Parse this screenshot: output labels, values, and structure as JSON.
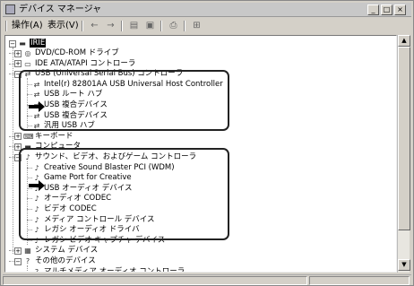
{
  "window": {
    "title": "デバイス マネージャ"
  },
  "menu": {
    "items": [
      "操作(A)",
      "表示(V)"
    ]
  },
  "toolbar": {
    "icons": [
      "back-icon",
      "forward-icon",
      "properties-icon",
      "refresh-icon",
      "print-icon",
      "scan-icon"
    ]
  },
  "tree": {
    "root": "IRIE",
    "nodes": [
      {
        "label": "DVD/CD-ROM ドライブ",
        "icon": "cdrom-icon",
        "level": 1,
        "expander": "+"
      },
      {
        "label": "IDE ATA/ATAPI コントローラ",
        "icon": "ide-icon",
        "level": 1,
        "expander": "+"
      },
      {
        "label": "USB (Universal Serial Bus) コントローラ",
        "icon": "usb-icon",
        "level": 1,
        "expander": "-"
      },
      {
        "label": "Intel(r) 82801AA USB Universal Host Controller",
        "icon": "usb-icon",
        "level": 2
      },
      {
        "label": "USB ルート ハブ",
        "icon": "usb-icon",
        "level": 2
      },
      {
        "label": "USB 複合デバイス",
        "icon": "usb-icon",
        "level": 2
      },
      {
        "label": "USB 複合デバイス",
        "icon": "usb-icon",
        "level": 2
      },
      {
        "label": "汎用 USB ハブ",
        "icon": "usb-icon",
        "level": 2
      },
      {
        "label": "キーボード",
        "icon": "keyboard-icon",
        "level": 1,
        "expander": "+"
      },
      {
        "label": "コンピュータ",
        "icon": "computer-icon",
        "level": 1,
        "expander": "+"
      },
      {
        "label": "サウンド、ビデオ、およびゲーム コントローラ",
        "icon": "sound-icon",
        "level": 1,
        "expander": "-"
      },
      {
        "label": "Creative Sound Blaster PCI (WDM)",
        "icon": "sound-icon",
        "level": 2
      },
      {
        "label": "Game Port for Creative",
        "icon": "sound-icon",
        "level": 2
      },
      {
        "label": "USB オーディオ デバイス",
        "icon": "sound-icon",
        "level": 2
      },
      {
        "label": "オーディオ CODEC",
        "icon": "sound-icon",
        "level": 2
      },
      {
        "label": "ビデオ CODEC",
        "icon": "sound-icon",
        "level": 2
      },
      {
        "label": "メディア コントロール デバイス",
        "icon": "sound-icon",
        "level": 2
      },
      {
        "label": "レガシ オーディオ ドライバ",
        "icon": "sound-icon",
        "level": 2
      },
      {
        "label": "レガシ ビデオ キャプチャ デバイス",
        "icon": "sound-icon",
        "level": 2
      },
      {
        "label": "システム デバイス",
        "icon": "system-icon",
        "level": 1,
        "expander": "+"
      },
      {
        "label": "その他のデバイス",
        "icon": "unknown-device-icon",
        "level": 1,
        "expander": "-"
      },
      {
        "label": "マルチメディア オーディオ コントローラ",
        "icon": "unknown-device-icon",
        "level": 2
      }
    ]
  },
  "colors": {
    "highlight_border": "#222222",
    "pointer": "#000000"
  }
}
